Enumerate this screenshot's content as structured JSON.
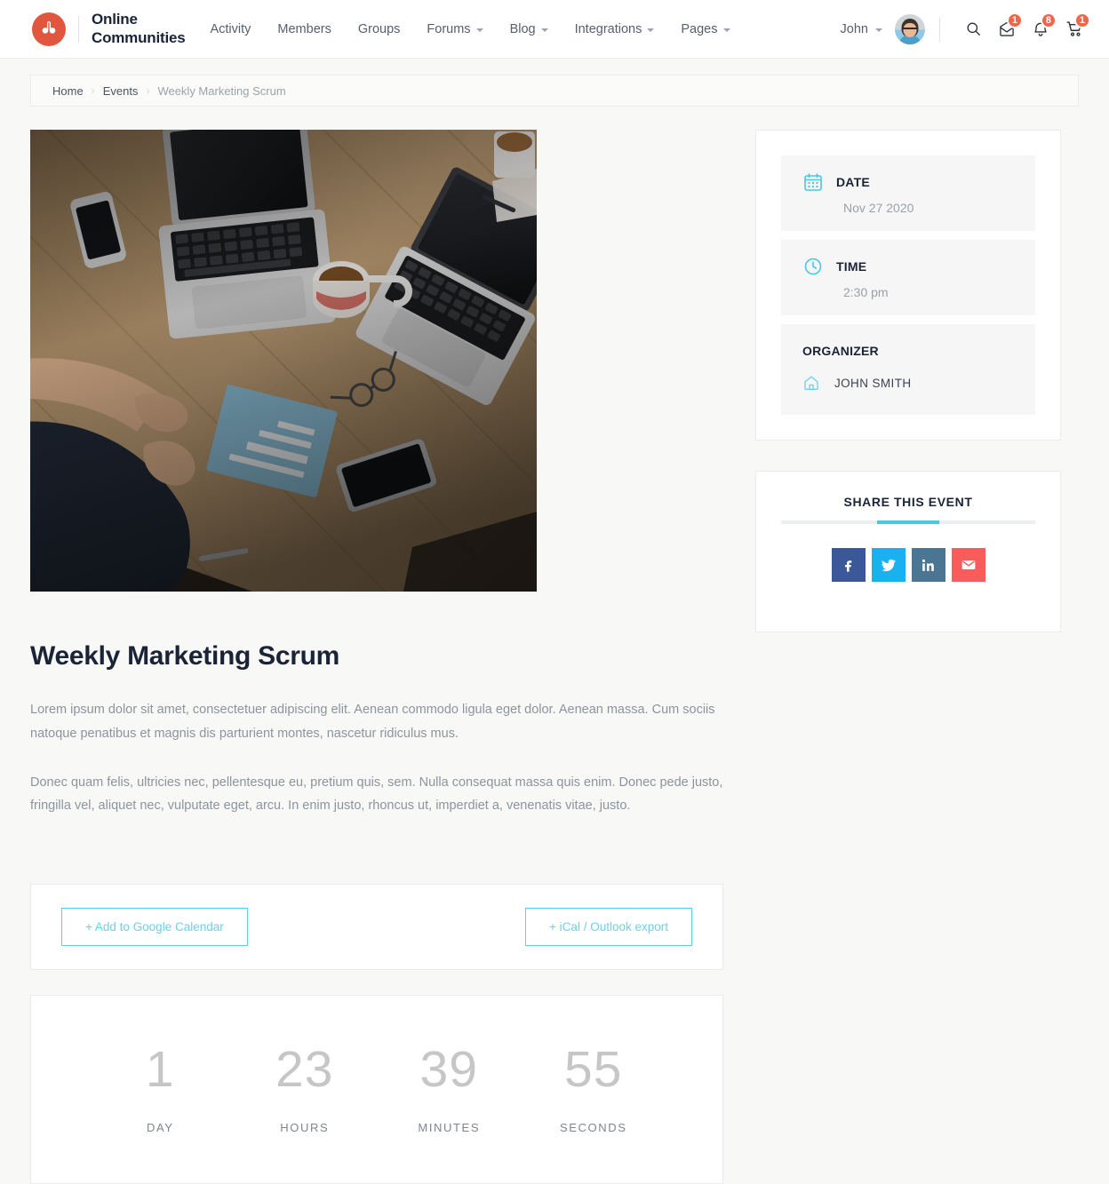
{
  "header": {
    "brand": {
      "line1": "Online",
      "line2": "Communities",
      "logo_icon": "buddyboss-logo-icon",
      "logo_color": "#e1563f"
    },
    "nav": [
      {
        "label": "Activity",
        "has_caret": false
      },
      {
        "label": "Members",
        "has_caret": false
      },
      {
        "label": "Groups",
        "has_caret": false
      },
      {
        "label": "Forums",
        "has_caret": true
      },
      {
        "label": "Blog",
        "has_caret": true
      },
      {
        "label": "Integrations",
        "has_caret": true
      },
      {
        "label": "Pages",
        "has_caret": true
      }
    ],
    "user": {
      "name": "John",
      "avatar_icon": "user-avatar"
    },
    "actions": [
      {
        "icon": "search-icon",
        "badge": null
      },
      {
        "icon": "messages-inbox-icon",
        "badge": "1"
      },
      {
        "icon": "notifications-bell-icon",
        "badge": "8"
      },
      {
        "icon": "shopping-cart-icon",
        "badge": "1"
      }
    ],
    "badge_color": "#f1664a"
  },
  "breadcrumb": {
    "items": [
      "Home",
      "Events",
      "Weekly Marketing Scrum"
    ],
    "separator": "›"
  },
  "hero": {
    "alt": "overhead view of desk with laptops, coffee mug, phone and notebook"
  },
  "event": {
    "title": "Weekly Marketing Scrum",
    "paragraphs": [
      "Lorem ipsum dolor sit amet, consectetuer adipiscing elit. Aenean commodo ligula eget dolor. Aenean massa. Cum sociis natoque penatibus et magnis dis parturient montes, nascetur ridiculus mus.",
      "Donec quam felis, ultricies nec, pellentesque eu, pretium quis, sem. Nulla consequat massa quis enim. Donec pede justo, fringilla vel, aliquet nec, vulputate eget, arcu. In enim justo, rhoncus ut, imperdiet a, venenatis vitae, justo."
    ]
  },
  "calendar_actions": {
    "google_label": "+ Add to Google Calendar",
    "ical_label": "+ iCal / Outlook export",
    "accent": "#58d0ec"
  },
  "countdown": {
    "units": [
      {
        "value": "1",
        "label": "DAY"
      },
      {
        "value": "23",
        "label": "HOURS"
      },
      {
        "value": "39",
        "label": "MINUTES"
      },
      {
        "value": "55",
        "label": "SECONDS"
      }
    ]
  },
  "sidebar": {
    "details": {
      "date": {
        "icon": "calendar-icon",
        "title": "DATE",
        "value": "Nov 27 2020"
      },
      "time": {
        "icon": "clock-icon",
        "title": "TIME",
        "value": "2:30 pm"
      },
      "organizer": {
        "title": "ORGANIZER",
        "icon": "home-icon",
        "name": "JOHN SMITH"
      }
    },
    "share": {
      "title": "SHARE THIS EVENT",
      "accent": "#4ac6e6",
      "networks": [
        {
          "name": "facebook",
          "icon": "facebook-icon",
          "glyph": "f",
          "color": "#3b5998"
        },
        {
          "name": "twitter",
          "icon": "twitter-icon",
          "glyph": "🐦",
          "color": "#19b1ef"
        },
        {
          "name": "linkedin",
          "icon": "linkedin-icon",
          "glyph": "in",
          "color": "#4a7694"
        },
        {
          "name": "email",
          "icon": "email-icon",
          "glyph": "✉",
          "color": "#fa5c5c"
        }
      ]
    }
  }
}
